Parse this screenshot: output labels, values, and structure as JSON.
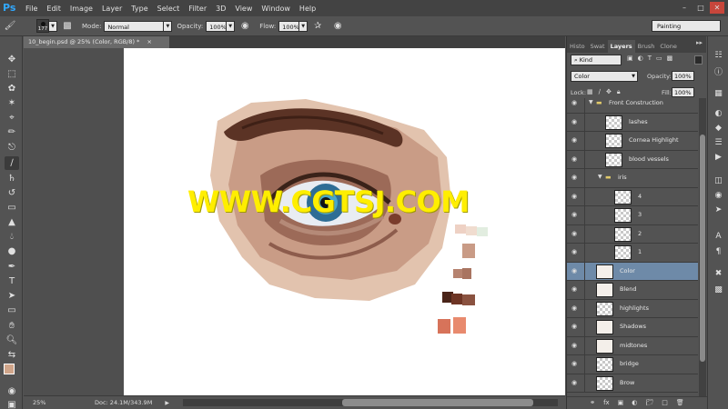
{
  "app": {
    "logo": "Ps",
    "menu": [
      "File",
      "Edit",
      "Image",
      "Layer",
      "Type",
      "Select",
      "Filter",
      "3D",
      "View",
      "Window",
      "Help"
    ],
    "window_buttons": [
      "–",
      "□",
      "✕"
    ]
  },
  "options_bar": {
    "brush_size": "177",
    "mode_label": "Mode:",
    "mode_value": "Normal",
    "opacity_label": "Opacity:",
    "opacity_value": "100%",
    "flow_label": "Flow:",
    "flow_value": "100%",
    "workspace": "Painting"
  },
  "document": {
    "tab_title": "10_begin.psd @ 25% (Color, RGB/8) *",
    "tab_close": "×",
    "watermark": "WWW.CGTSJ.COM"
  },
  "status_bar": {
    "zoom": "25%",
    "doc_info": "Doc: 24.1M/343.9M",
    "play": "▶"
  },
  "colors": {
    "foreground": "#d0a58a",
    "background": "#ffffff",
    "selection": "#6e8aa8"
  },
  "panel": {
    "tabs": [
      "Histo",
      "Swat",
      "Layers",
      "Brush",
      "Clone"
    ],
    "active_tab": "Layers",
    "menu_icon": "▸▸",
    "filter_value": "⌕ Kind",
    "blend_mode": "Color",
    "opacity_label": "Opacity:",
    "opacity_value": "100%",
    "lock_label": "Lock:",
    "fill_label": "Fill:",
    "fill_value": "100%"
  },
  "layers": [
    {
      "name": "Front Construction",
      "type": "group",
      "indent": 0
    },
    {
      "name": "lashes",
      "type": "layer",
      "indent": 1
    },
    {
      "name": "Cornea Highlight",
      "type": "layer",
      "indent": 1
    },
    {
      "name": "blood vessels",
      "type": "layer",
      "indent": 1
    },
    {
      "name": "iris",
      "type": "group",
      "indent": 1
    },
    {
      "name": "4",
      "type": "layer",
      "indent": 2
    },
    {
      "name": "3",
      "type": "layer",
      "indent": 2
    },
    {
      "name": "2",
      "type": "layer",
      "indent": 2
    },
    {
      "name": "1",
      "type": "layer",
      "indent": 2
    },
    {
      "name": "Color",
      "type": "art",
      "indent": 0,
      "selected": true
    },
    {
      "name": "Blend",
      "type": "art",
      "indent": 0
    },
    {
      "name": "highlights",
      "type": "layer",
      "indent": 0
    },
    {
      "name": "Shadows",
      "type": "art",
      "indent": 0
    },
    {
      "name": "midtones",
      "type": "art",
      "indent": 0
    },
    {
      "name": "bridge",
      "type": "layer",
      "indent": 0
    },
    {
      "name": "Brow",
      "type": "layer",
      "indent": 0
    }
  ]
}
